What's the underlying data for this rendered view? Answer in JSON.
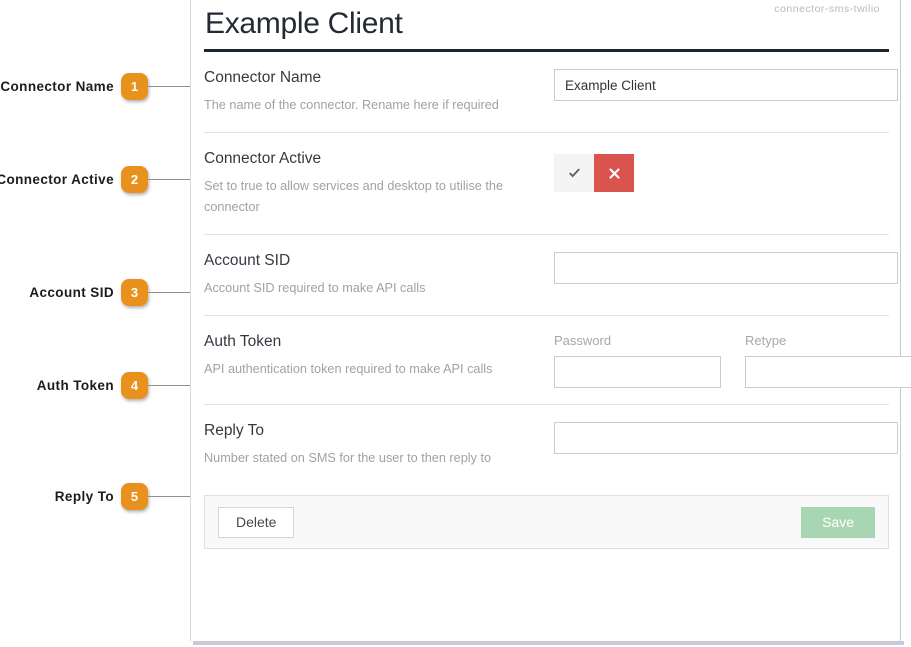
{
  "header": {
    "title": "Example Client",
    "connector_id": "connector-sms-twilio"
  },
  "annotations": [
    {
      "number": "1",
      "label": "Connector Name"
    },
    {
      "number": "2",
      "label": "Connector Active"
    },
    {
      "number": "3",
      "label": "Account SID"
    },
    {
      "number": "4",
      "label": "Auth Token"
    },
    {
      "number": "5",
      "label": "Reply To"
    }
  ],
  "form": {
    "rows": [
      {
        "label": "Connector Name",
        "description": "The name of the connector. Rename here if required",
        "value": "Example Client"
      },
      {
        "label": "Connector Active",
        "description": "Set to true to allow services and desktop to utilise the connector",
        "toggle": {
          "yes_icon": "check-icon",
          "no_icon": "cross-icon",
          "selected": "no"
        }
      },
      {
        "label": "Account SID",
        "description": "Account SID required to make API calls",
        "value": ""
      },
      {
        "label": "Auth Token",
        "description": "API authentication token required to make API calls",
        "password_label": "Password",
        "retype_label": "Retype",
        "password_value": "",
        "retype_value": ""
      },
      {
        "label": "Reply To",
        "description": "Number stated on SMS for the user to then reply to",
        "value": ""
      }
    ]
  },
  "footer": {
    "delete_label": "Delete",
    "save_label": "Save"
  },
  "colors": {
    "badge_orange": "#e8921d",
    "toggle_no_red": "#d9534f",
    "save_green": "#a9d6b2",
    "title_rule": "#1d2530"
  }
}
